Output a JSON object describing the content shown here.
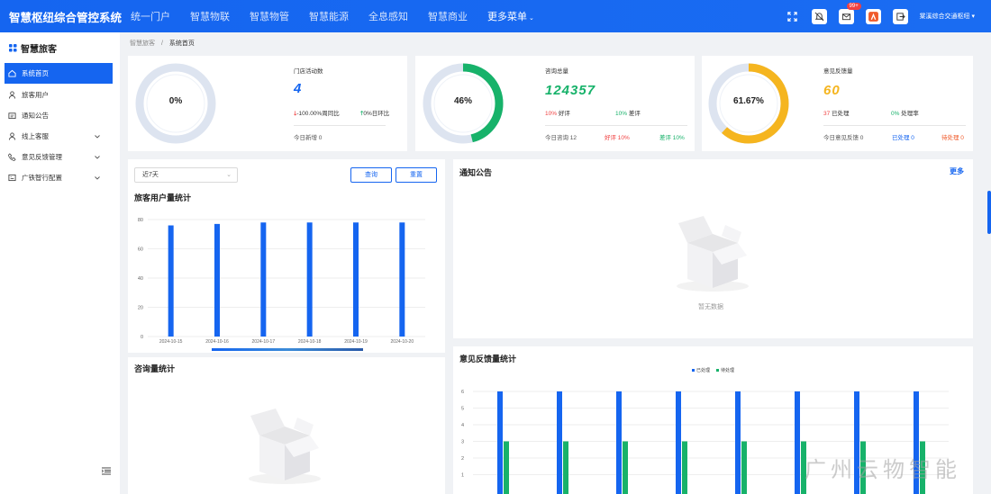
{
  "header": {
    "title": "智慧枢纽综合管控系统",
    "nav": [
      "统一门户",
      "智慧物联",
      "智慧物管",
      "智慧能源",
      "全息感知",
      "智慧商业"
    ],
    "more_menu": "更多菜单",
    "badge": "99+",
    "user": "棠溪综合交通枢纽"
  },
  "sidebar": {
    "title": "智慧旅客",
    "items": [
      {
        "label": "系统首页",
        "icon": "home-icon"
      },
      {
        "label": "旅客用户",
        "icon": "user-icon"
      },
      {
        "label": "通知公告",
        "icon": "notice-icon"
      },
      {
        "label": "线上客服",
        "icon": "service-icon"
      },
      {
        "label": "意见反馈管理",
        "icon": "phone-icon"
      },
      {
        "label": "广铁智行配置",
        "icon": "config-icon"
      }
    ]
  },
  "breadcrumb": {
    "parent": "智慧旅客",
    "separator": "/",
    "current": "系统首页"
  },
  "stats": {
    "store": {
      "percent": "0%",
      "percent_value": 0,
      "label": "门店活动数",
      "value": "4",
      "week": "-100.00%周同比",
      "day": "0%日环比",
      "today": "今日新增 0"
    },
    "consult": {
      "percent": "46%",
      "percent_value": 46,
      "label": "咨询总量",
      "value": "124357",
      "good_pct": "10%",
      "good_label": "好评",
      "bad_pct": "10%",
      "bad_label": "差评",
      "today": "今日咨询 12",
      "good_today": "好评 10%",
      "bad_today": "差评 10%"
    },
    "feedback": {
      "percent": "61.67%",
      "percent_value": 61.67,
      "label": "意见反馈量",
      "value": "60",
      "done_count": "37",
      "done_label": "已处理",
      "rate_pct": "0%",
      "rate_label": "处理率",
      "today": "今日意见反馈 0",
      "done_today": "已处理 0",
      "pending_today": "待处理 0"
    }
  },
  "filter": {
    "range": "近7天",
    "query": "查询",
    "reset": "重置"
  },
  "sections": {
    "user_stats": "旅客用户量统计",
    "consult_stats": "咨询量统计",
    "notice": "通知公告",
    "notice_more": "更多",
    "empty": "暂无数据",
    "feedback_stats": "意见反馈量统计"
  },
  "watermark": "广州云物智能",
  "colors": {
    "primary": "#1565f0",
    "green": "#17b26a",
    "yellow": "#f5b51f",
    "red": "#f04040"
  },
  "chart_data": [
    {
      "type": "bar",
      "title": "旅客用户量统计",
      "categories": [
        "2024-10-15",
        "2024-10-16",
        "2024-10-17",
        "2024-10-18",
        "2024-10-19",
        "2024-10-20"
      ],
      "values": [
        76,
        77,
        78,
        78,
        78,
        78
      ],
      "ylim": [
        0,
        80
      ],
      "yticks": [
        0,
        20,
        40,
        60,
        80
      ],
      "grid": true
    },
    {
      "type": "bar",
      "title": "意见反馈量统计",
      "series": [
        {
          "name": "已处理",
          "values": [
            6,
            6,
            6,
            6,
            6,
            6,
            6,
            6
          ],
          "color": "#1565f0"
        },
        {
          "name": "待处理",
          "values": [
            3,
            3,
            3,
            3,
            3,
            3,
            3,
            3
          ],
          "color": "#17b26a"
        }
      ],
      "ylim": [
        0,
        6
      ],
      "yticks": [
        1,
        2,
        3,
        4,
        5,
        6
      ],
      "legend": "top-center",
      "grid": true
    }
  ]
}
